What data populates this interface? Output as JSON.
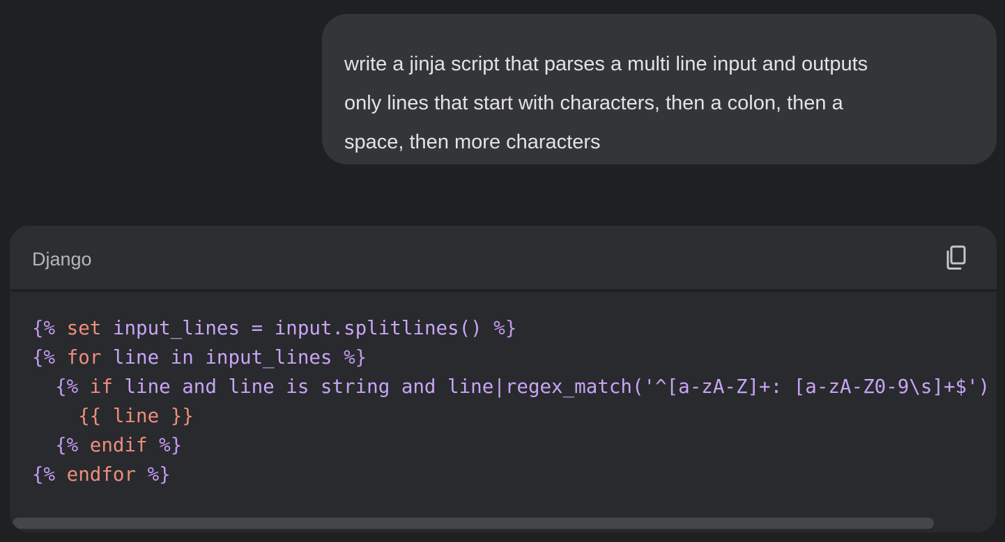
{
  "user_message": {
    "text": "write a jinja script that parses a multi line input and outputs\nonly lines that start with characters, then a colon, then a\nspace, then more characters"
  },
  "code_block": {
    "language": "Django",
    "copy_icon": "copy-icon",
    "lines": [
      [
        {
          "t": "{%",
          "c": "pu"
        },
        {
          "t": " set ",
          "c": "kw"
        },
        {
          "t": "input_lines = input.splitlines() ",
          "c": "tx"
        },
        {
          "t": "%}",
          "c": "pu"
        }
      ],
      [
        {
          "t": "{%",
          "c": "pu"
        },
        {
          "t": " for ",
          "c": "kw"
        },
        {
          "t": "line in input_lines ",
          "c": "tx"
        },
        {
          "t": "%}",
          "c": "pu"
        }
      ],
      [
        {
          "t": "  {%",
          "c": "pu"
        },
        {
          "t": " if ",
          "c": "kw"
        },
        {
          "t": "line and line is string and line|regex_match('^[a-zA-Z]+: [a-zA-Z0-9\\s]+$')",
          "c": "tx"
        }
      ],
      [
        {
          "t": "    {{",
          "c": "kw"
        },
        {
          "t": " line ",
          "c": "kw"
        },
        {
          "t": "}}",
          "c": "kw"
        }
      ],
      [
        {
          "t": "  {%",
          "c": "pu"
        },
        {
          "t": " endif ",
          "c": "kw"
        },
        {
          "t": "%}",
          "c": "pu"
        }
      ],
      [
        {
          "t": "{%",
          "c": "pu"
        },
        {
          "t": " endfor ",
          "c": "kw"
        },
        {
          "t": "%}",
          "c": "pu"
        }
      ]
    ]
  },
  "colors": {
    "background": "#1f2022",
    "bubble": "#333537",
    "code_bg": "#282a2d",
    "keyword": "#ee8d7e",
    "text": "#c9a4f5"
  }
}
